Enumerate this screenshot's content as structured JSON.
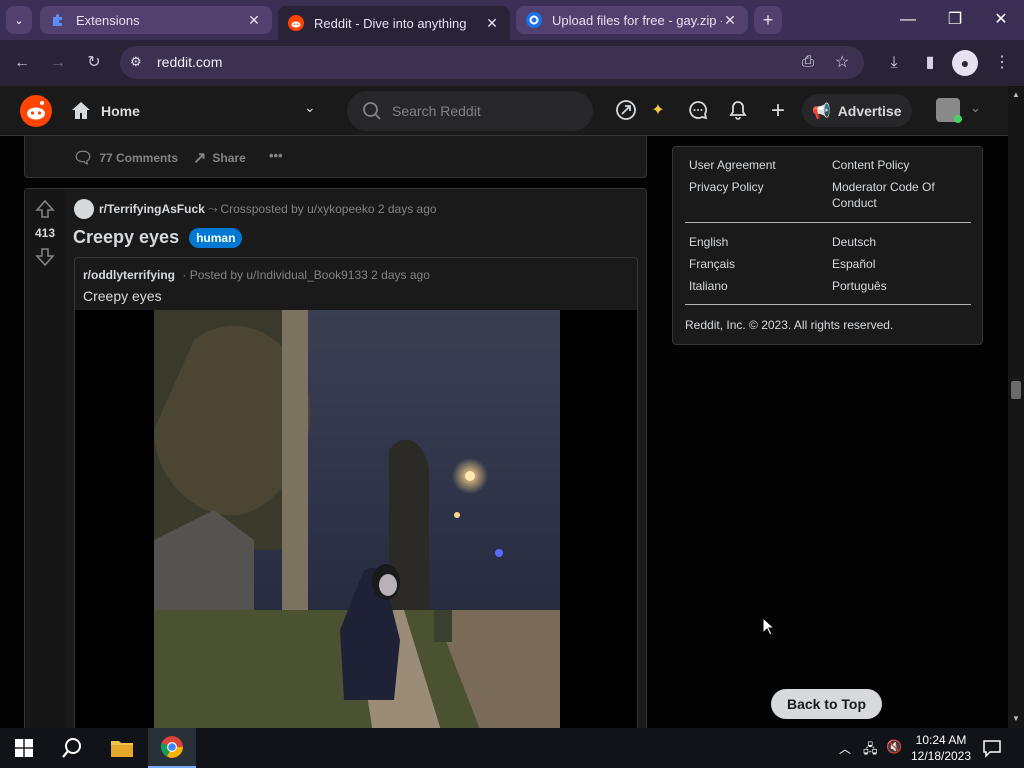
{
  "browser": {
    "tabs": [
      {
        "label": "Extensions",
        "icon": "puzzle-icon",
        "close": "✕"
      },
      {
        "label": "Reddit - Dive into anything",
        "icon": "reddit-icon",
        "close": "✕"
      },
      {
        "label": "Upload files for free - gay.zip -",
        "icon": "upload-site-icon",
        "close": "✕"
      }
    ],
    "new_tab": "+",
    "url": "reddit.com"
  },
  "reddit_header": {
    "home_label": "Home",
    "search_placeholder": "Search Reddit",
    "advertise_label": "Advertise"
  },
  "feed": {
    "prev_post": {
      "comments_label": "77 Comments",
      "share_label": "Share",
      "more": "•••"
    },
    "post": {
      "votes": "413",
      "subreddit": "r/TerrifyingAsFuck",
      "crosspost_meta": "Crossposted by u/xykopeeko 2 days ago",
      "title": "Creepy eyes",
      "flair": "human",
      "original": {
        "subreddit": "r/oddlyterrifying",
        "meta": "· Posted by u/Individual_Book9133 2 days ago",
        "title": "Creepy eyes"
      }
    }
  },
  "sidebar": {
    "links_row1": [
      "User Agreement",
      "Content Policy"
    ],
    "links_row2": [
      "Privacy Policy",
      "Moderator Code Of",
      "Conduct"
    ],
    "languages": [
      "English",
      "Deutsch",
      "Français",
      "Español",
      "Italiano",
      "Português"
    ],
    "copyright": "Reddit, Inc. © 2023. All rights reserved."
  },
  "back_to_top": "Back to Top",
  "taskbar": {
    "time": "10:24 AM",
    "date": "12/18/2023"
  },
  "colors": {
    "reddit_orange": "#ff4500",
    "flair_blue": "#0079d3",
    "chrome_purple": "#3c2f55"
  }
}
